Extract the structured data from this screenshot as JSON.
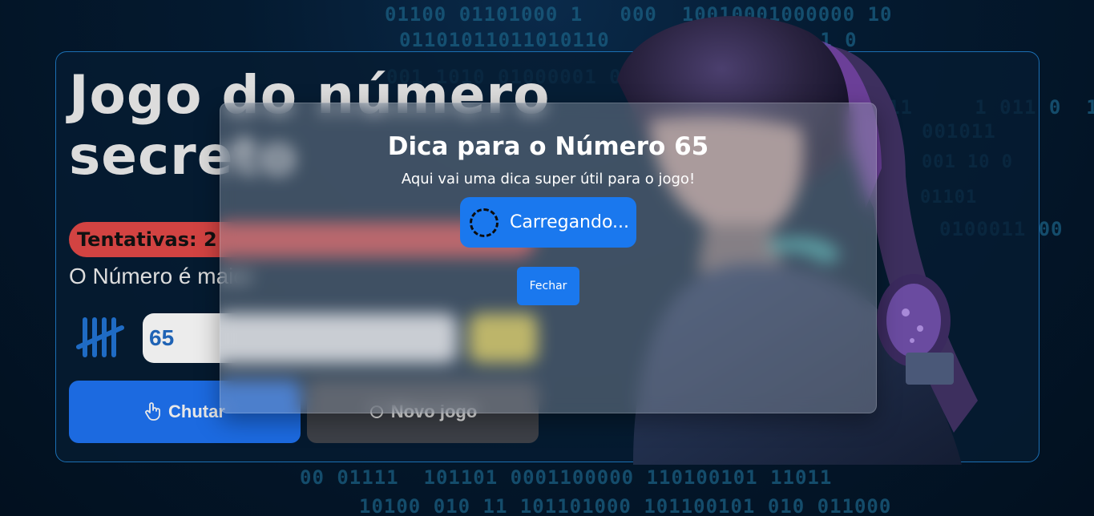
{
  "game": {
    "title": "Jogo do número secreto",
    "attempts": "Tentativas: 2",
    "hint": "O Número é maior",
    "input_value": "65",
    "guess_label": "Chutar",
    "new_game_label": "Novo jogo"
  },
  "modal": {
    "title": "Dica para o Número 65",
    "subtitle": "Aqui vai uma dica super útil para o jogo!",
    "loading": "Carregando...",
    "close_label": "Fechar"
  },
  "background": {
    "binary_rows": [
      "01100 01101000 1   000  10010001000000 10",
      "01101011011010110     1011  01110 1 0",
      "001 1010 01000001 01100001 1101000010",
      "0 1 1  01 1010  0111     1 011 0  1  0",
      "001011",
      "001 10 0",
      "01101",
      "0100011 00",
      "00 01111  101101 0001100000 110100101 11011",
      "10100 010 11 101101000 101100101 010 011000"
    ]
  },
  "colors": {
    "accent": "#1a78ee",
    "attempts_bg": "#d24342",
    "card_border": "#1b6fb3",
    "keypad": "#d8c43c"
  },
  "icons": [
    "tally-icon",
    "hand-pointer-icon",
    "circle-icon",
    "keypad-icon",
    "spinner-icon"
  ]
}
